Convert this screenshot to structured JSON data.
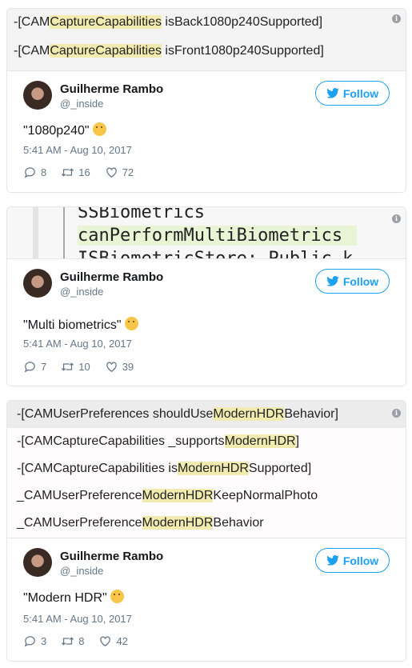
{
  "tweets": [
    {
      "media_lines": [
        [
          "-[CAM",
          "CaptureCapabilities",
          " isBack1080p240Supported]"
        ],
        [
          "-[CAM",
          "CaptureCapabilities",
          " isFront1080p240Supported]"
        ]
      ],
      "author": "Guilherme Rambo",
      "handle": "@_inside",
      "follow_label": "Follow",
      "text": "\"1080p240\"",
      "date": "5:41 AM - Aug 10, 2017",
      "replies": "8",
      "retweets": "16",
      "likes": "72"
    },
    {
      "media_code": [
        "SSBiometrics",
        "canPerformMultiBiometrics",
        "ISBiometricStore: Public_k"
      ],
      "author": "Guilherme Rambo",
      "handle": "@_inside",
      "follow_label": "Follow",
      "text": "\"Multi biometrics\"",
      "date": "5:41 AM - Aug 10, 2017",
      "replies": "7",
      "retweets": "10",
      "likes": "39"
    },
    {
      "media_lines": [
        [
          "-[CAMUserPreferences shouldUse",
          "ModernHDR",
          "Behavior]"
        ],
        [
          "-[CAMCaptureCapabilities _supports",
          "ModernHDR",
          "]"
        ],
        [
          "-[CAMCaptureCapabilities is",
          "ModernHDR",
          "Supported]"
        ],
        [
          "_CAMUserPreference",
          "ModernHDR",
          "KeepNormalPhoto"
        ],
        [
          "_CAMUserPreference",
          "ModernHDR",
          "Behavior"
        ]
      ],
      "author": "Guilherme Rambo",
      "handle": "@_inside",
      "follow_label": "Follow",
      "text": "\"Modern HDR\"",
      "date": "5:41 AM - Aug 10, 2017",
      "replies": "3",
      "retweets": "8",
      "likes": "42"
    }
  ],
  "colors": {
    "twitter_blue": "#1da1f2",
    "meta_gray": "#657786",
    "highlight": "#f1ebb0"
  },
  "icons": [
    "info-icon",
    "twitter-bird-icon",
    "thinking-face-emoji",
    "reply-icon",
    "retweet-icon",
    "like-icon"
  ]
}
